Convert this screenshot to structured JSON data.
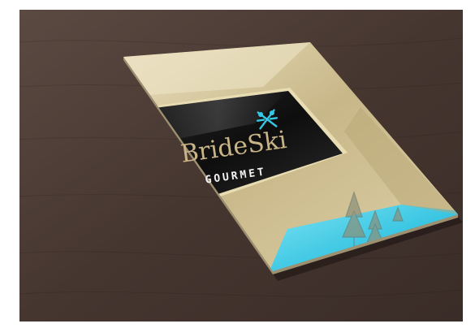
{
  "card": {
    "brand_name": "BrideSki",
    "tagline": "GOURMET"
  },
  "icons": {
    "logo": "crossed-ski-poles-icon"
  },
  "colors": {
    "table_wood": "#4a3a33",
    "card_gold": "#cdbd8f",
    "card_gold_light": "#e6dbb8",
    "accent_cyan": "#35c7e4",
    "panel_black": "#141414",
    "brand_text": "#c9b487"
  }
}
